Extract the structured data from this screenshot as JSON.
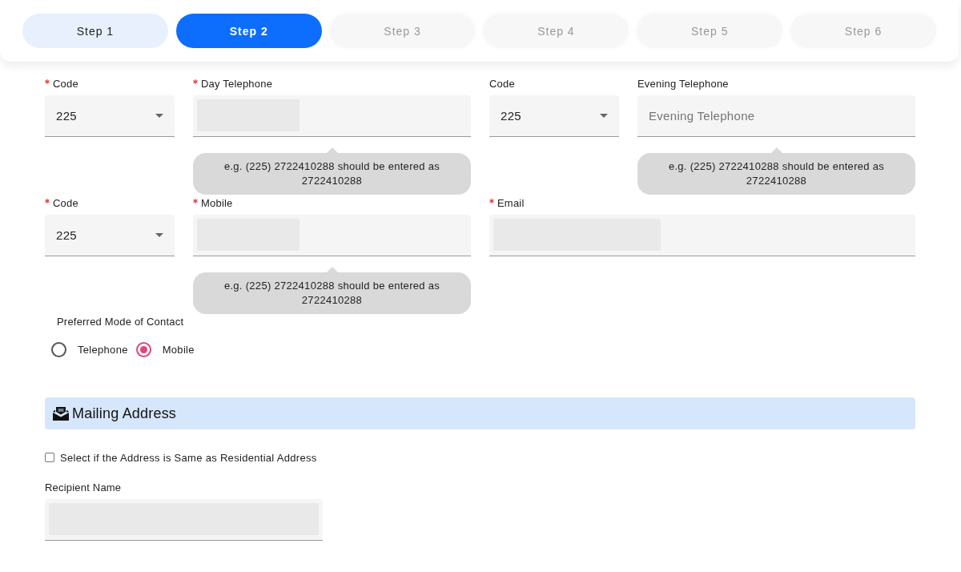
{
  "steps": [
    {
      "label": "Step 1",
      "selected": false,
      "completed": true
    },
    {
      "label": "Step 2",
      "selected": true,
      "completed": false
    },
    {
      "label": "Step 3",
      "selected": false,
      "completed": false
    },
    {
      "label": "Step 4",
      "selected": false,
      "completed": false
    },
    {
      "label": "Step 5",
      "selected": false,
      "completed": false
    },
    {
      "label": "Step 6",
      "selected": false,
      "completed": false
    }
  ],
  "contact_rows": [
    {
      "fields": [
        {
          "kind": "code",
          "label": "Code",
          "required": true,
          "value": "225"
        },
        {
          "kind": "phone",
          "label": "Day Telephone",
          "required": true,
          "redacted": true,
          "hint": "e.g. (225) 2722410288 should be entered as 2722410288"
        },
        {
          "kind": "code",
          "label": "Code",
          "required": false,
          "value": "225"
        },
        {
          "kind": "phone",
          "label": "Evening Telephone",
          "required": false,
          "redacted": false,
          "placeholder": "Evening Telephone",
          "hint": "e.g. (225) 2722410288 should be entered as 2722410288"
        }
      ]
    },
    {
      "fields": [
        {
          "kind": "code",
          "label": "Code",
          "required": true,
          "value": "225"
        },
        {
          "kind": "phone",
          "label": "Mobile",
          "required": true,
          "redacted": true,
          "hint": "e.g. (225) 2722410288 should be entered as 2722410288"
        },
        {
          "kind": "email",
          "label": "Email",
          "required": true,
          "redacted": true
        }
      ]
    }
  ],
  "preferred_contact": {
    "label": "Preferred Mode of Contact",
    "options": [
      {
        "label": "Telephone",
        "selected": false
      },
      {
        "label": "Mobile",
        "selected": true
      }
    ]
  },
  "mailing_address": {
    "title": "Mailing Address",
    "same_as_residential": {
      "label": "Select if the Address is Same as Residential Address",
      "checked": false
    },
    "recipient_name": {
      "label": "Recipient Name",
      "redacted": true
    }
  }
}
